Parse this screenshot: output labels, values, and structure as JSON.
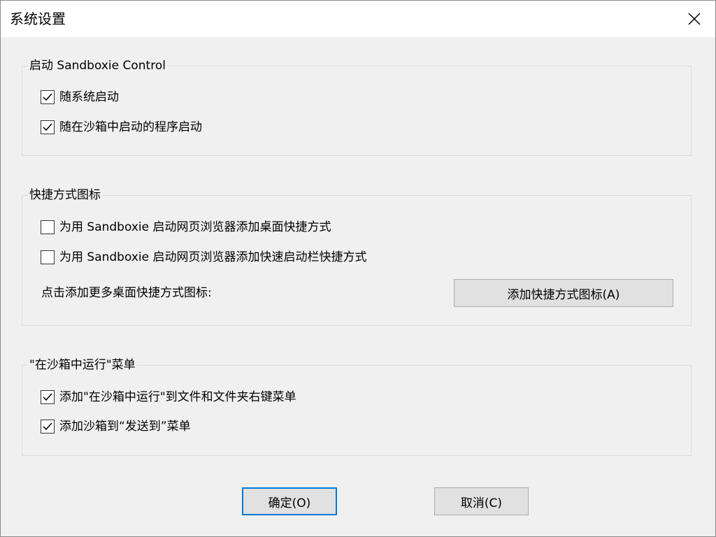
{
  "window": {
    "title": "系统设置",
    "close_icon": "close-icon"
  },
  "startup_group": {
    "legend": "启动 Sandboxie Control",
    "options": [
      {
        "label": "随系统启动",
        "checked": true
      },
      {
        "label": "随在沙箱中启动的程序启动",
        "checked": true
      }
    ]
  },
  "shortcut_group": {
    "legend": "快捷方式图标",
    "options": [
      {
        "label": "为用 Sandboxie 启动网页浏览器添加桌面快捷方式",
        "checked": false
      },
      {
        "label": "为用 Sandboxie 启动网页浏览器添加快速启动栏快捷方式",
        "checked": false
      }
    ],
    "more_text": "点击添加更多桌面快捷方式图标:",
    "add_button_label": "添加快捷方式图标(A)"
  },
  "run_menu_group": {
    "legend": "\"在沙箱中运行\"菜单",
    "options": [
      {
        "label": "添加\"在沙箱中运行\"到文件和文件夹右键菜单",
        "checked": true
      },
      {
        "label": "添加沙箱到“发送到”菜单",
        "checked": true
      }
    ]
  },
  "footer": {
    "ok_label": "确定(O)",
    "cancel_label": "取消(C)"
  }
}
